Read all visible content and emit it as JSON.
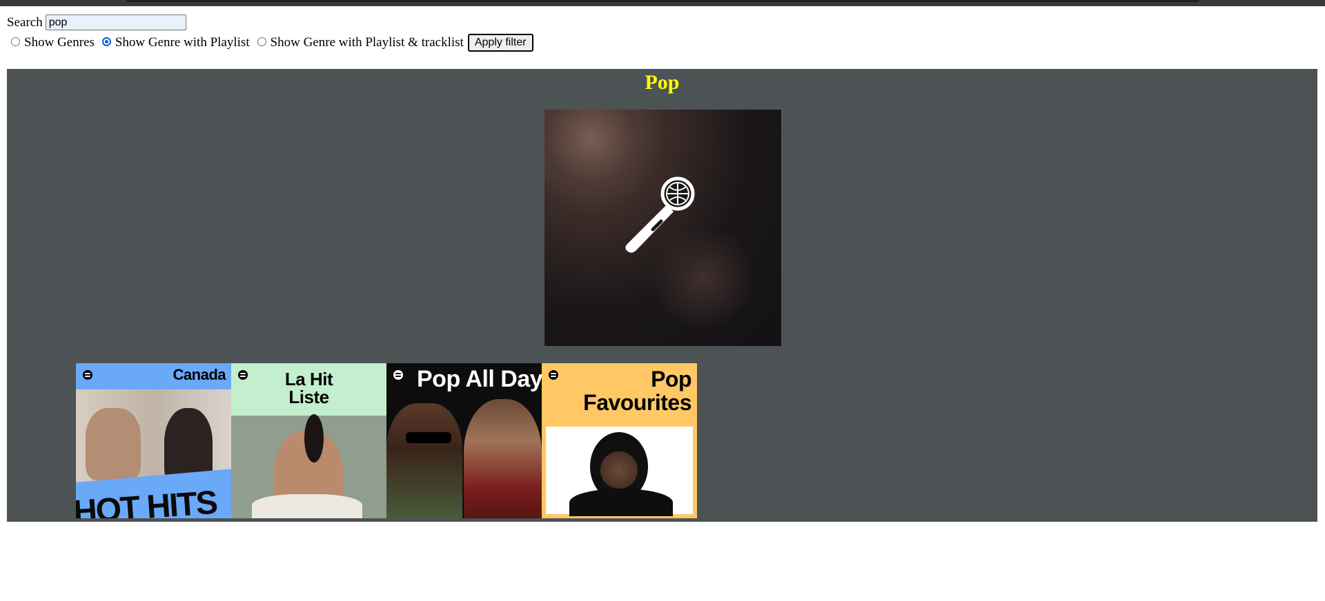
{
  "search": {
    "label": "Search",
    "value": "pop"
  },
  "filters": {
    "options": [
      {
        "label": "Show Genres",
        "checked": false
      },
      {
        "label": "Show Genre with Playlist",
        "checked": true
      },
      {
        "label": "Show Genre with Playlist & tracklist",
        "checked": false
      }
    ],
    "apply_label": "Apply filter"
  },
  "genre": {
    "title": "Pop",
    "title_color": "#ffff00",
    "panel_color": "#4d5354",
    "playlists": [
      {
        "title": "Canada",
        "subtitle": "HOT HITS"
      },
      {
        "title_line1": "La Hit",
        "title_line2": "Liste"
      },
      {
        "title": "Pop All Day"
      },
      {
        "title_line1": "Pop",
        "title_line2": "Favourites"
      }
    ]
  }
}
